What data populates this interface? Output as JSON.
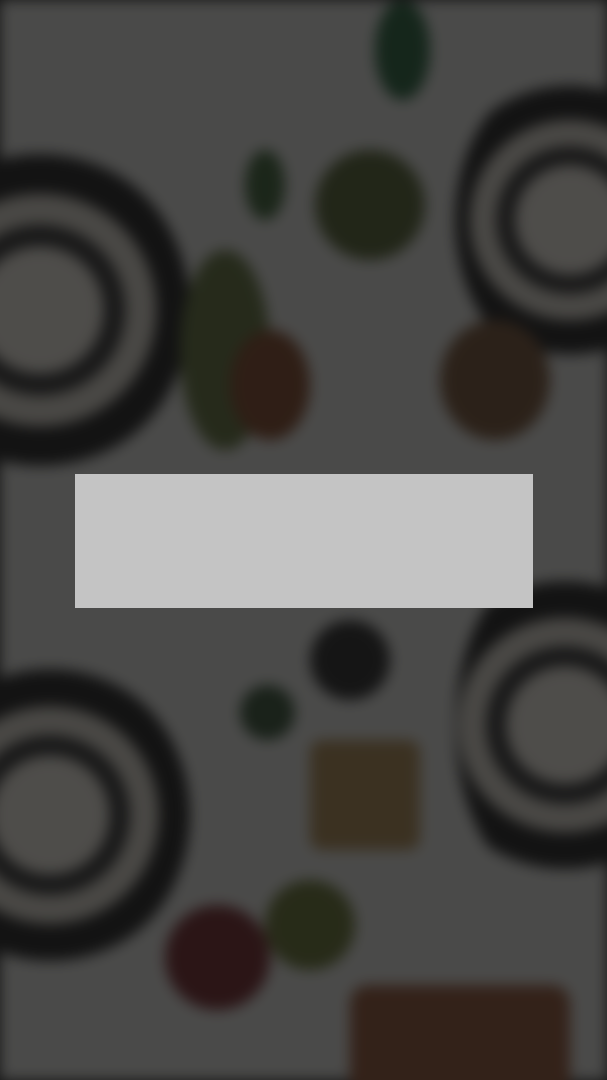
{
  "background": {
    "image": "blurred-food-table-photo",
    "overlay_color": "#121212"
  },
  "placeholder_panel": {
    "color": "#c4c4c4"
  }
}
